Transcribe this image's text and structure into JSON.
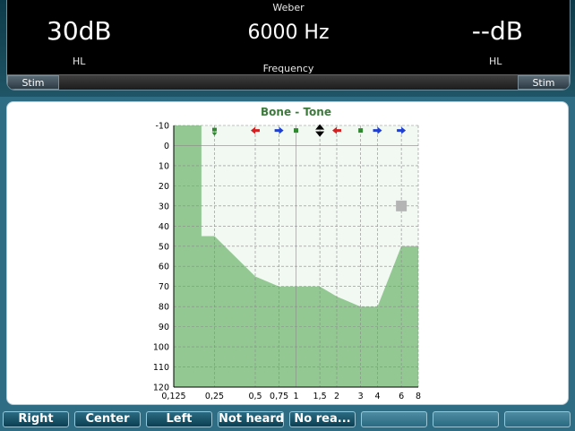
{
  "header": {
    "mode": "Weber",
    "left_level": "30dB",
    "left_unit": "HL",
    "frequency": "6000 Hz",
    "frequency_label": "Frequency",
    "right_level": "--dB",
    "right_unit": "HL",
    "stim_left": "Stim",
    "stim_right": "Stim"
  },
  "chart_data": {
    "type": "area",
    "title": "Bone - Tone",
    "title_color": "#3c7a3c",
    "x_ticks": [
      "0,125",
      "0,25",
      "0,5",
      "0,75",
      "1",
      "1,5",
      "2",
      "3",
      "4",
      "6",
      "8"
    ],
    "x_ticks_khz": [
      0.125,
      0.25,
      0.5,
      0.75,
      1,
      1.5,
      2,
      3,
      4,
      6,
      8
    ],
    "y_ticks": [
      -10,
      0,
      10,
      20,
      30,
      40,
      50,
      60,
      70,
      80,
      90,
      100,
      110,
      120
    ],
    "ylim": [
      -10,
      120
    ],
    "y_inverted": true,
    "x_scale": "log",
    "grid": true,
    "limit_curve": {
      "name": "",
      "x_khz": [
        0.125,
        0.2,
        0.2,
        0.25,
        0.5,
        0.75,
        1,
        1.5,
        2,
        3,
        4,
        6,
        8
      ],
      "y_db": [
        -10,
        -10,
        45,
        45,
        65,
        70,
        70,
        70,
        75,
        80,
        80,
        50,
        50
      ]
    },
    "current_point": {
      "x_khz": 6,
      "y_db": 30
    },
    "top_markers": [
      {
        "x_khz": 0.25,
        "marker": "green-square-down-arrow",
        "color": "#2f8a2f"
      },
      {
        "x_khz": 0.5,
        "marker": "left-arrow",
        "color": "#d42020"
      },
      {
        "x_khz": 0.75,
        "marker": "right-arrow",
        "color": "#1f3fd0"
      },
      {
        "x_khz": 1,
        "marker": "square",
        "color": "#2f8a2f"
      },
      {
        "x_khz": 1.5,
        "marker": "up-down-arrow",
        "color": "#000000"
      },
      {
        "x_khz": 2,
        "marker": "left-arrow",
        "color": "#d42020"
      },
      {
        "x_khz": 3,
        "marker": "square",
        "color": "#2f8a2f"
      },
      {
        "x_khz": 4,
        "marker": "right-arrow",
        "color": "#1f3fd0"
      },
      {
        "x_khz": 6,
        "marker": "right-arrow",
        "color": "#1f3fd0"
      }
    ],
    "colors": {
      "fill": "#93c893",
      "band": "#f2f8f2",
      "current_point": "#b4b4b4"
    }
  },
  "buttons": [
    {
      "label": "Right"
    },
    {
      "label": "Center"
    },
    {
      "label": "Left"
    },
    {
      "label": "Not heard"
    },
    {
      "label": "No rea..."
    },
    {
      "label": ""
    },
    {
      "label": ""
    },
    {
      "label": ""
    }
  ]
}
